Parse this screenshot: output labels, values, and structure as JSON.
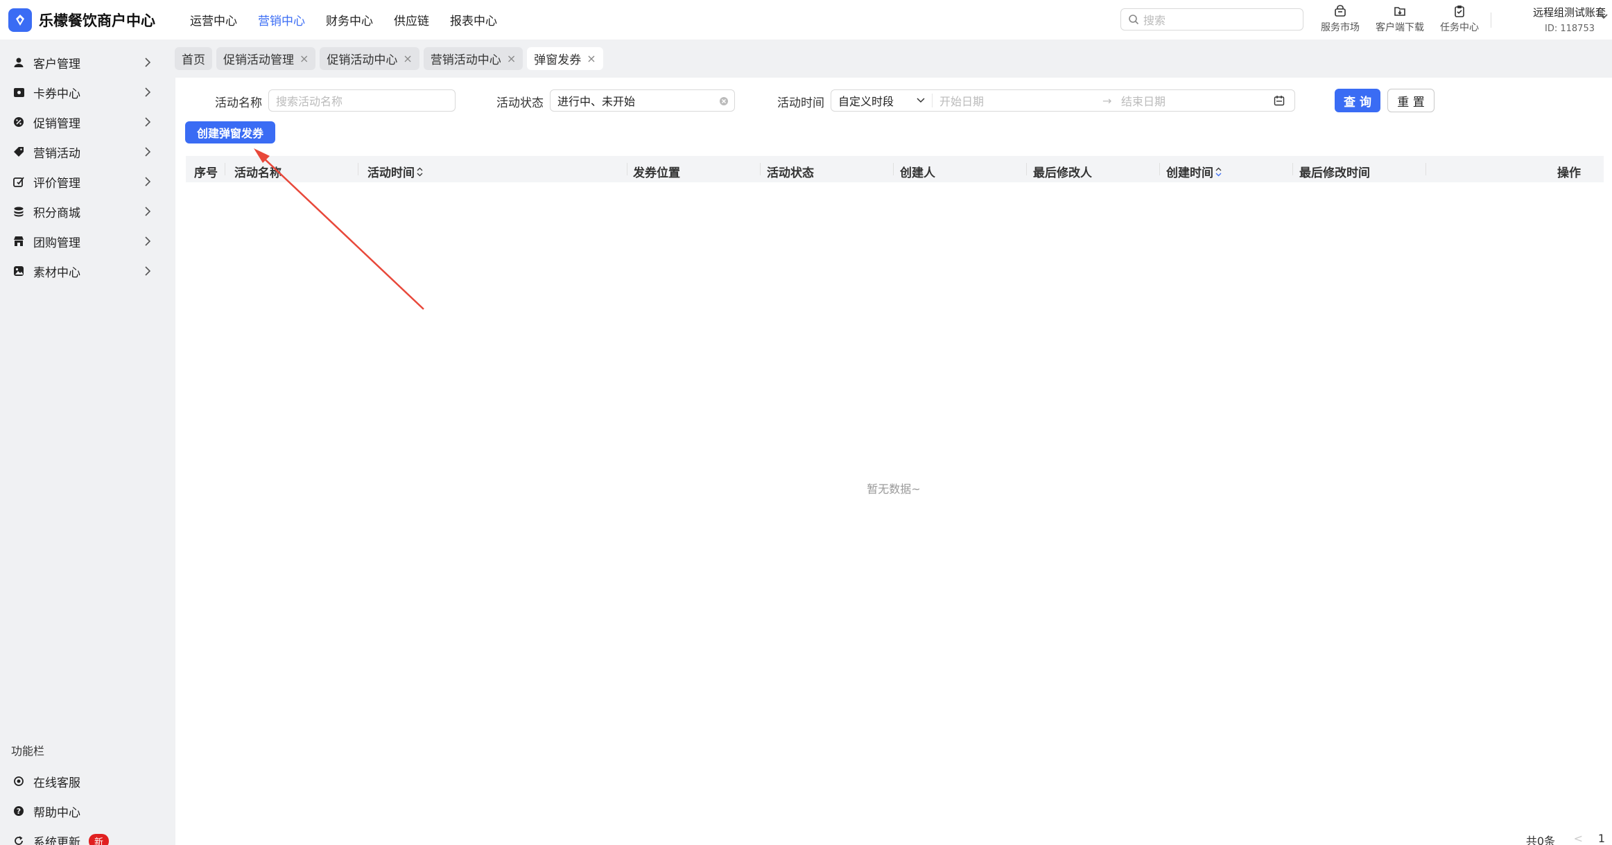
{
  "app": {
    "title": "乐檬餐饮商户中心"
  },
  "topnav": [
    {
      "label": "运营中心",
      "active": false
    },
    {
      "label": "营销中心",
      "active": true
    },
    {
      "label": "财务中心",
      "active": false
    },
    {
      "label": "供应链",
      "active": false
    },
    {
      "label": "报表中心",
      "active": false
    }
  ],
  "search": {
    "placeholder": "搜索"
  },
  "tools": [
    {
      "label": "服务市场",
      "icon": "store-icon"
    },
    {
      "label": "客户端下载",
      "icon": "download-icon"
    },
    {
      "label": "任务中心",
      "icon": "clipboard-icon"
    }
  ],
  "account": {
    "name": "远程组测试账套",
    "id": "ID: 118753"
  },
  "sidebar": {
    "items": [
      {
        "label": "客户管理",
        "icon": "user-icon"
      },
      {
        "label": "卡券中心",
        "icon": "card-icon"
      },
      {
        "label": "促销管理",
        "icon": "promo-icon"
      },
      {
        "label": "营销活动",
        "icon": "tag-icon"
      },
      {
        "label": "评价管理",
        "icon": "review-icon"
      },
      {
        "label": "积分商城",
        "icon": "points-icon"
      },
      {
        "label": "团购管理",
        "icon": "shop-icon"
      },
      {
        "label": "素材中心",
        "icon": "image-icon"
      }
    ],
    "function_title": "功能栏",
    "function_items": [
      {
        "label": "在线客服",
        "icon": "headset-icon"
      },
      {
        "label": "帮助中心",
        "icon": "help-icon"
      },
      {
        "label": "系统更新",
        "icon": "refresh-icon",
        "badge": "新"
      }
    ]
  },
  "tabs": [
    {
      "label": "首页",
      "closable": false,
      "active": false
    },
    {
      "label": "促销活动管理",
      "closable": true,
      "active": false
    },
    {
      "label": "促销活动中心",
      "closable": true,
      "active": false
    },
    {
      "label": "营销活动中心",
      "closable": true,
      "active": false
    },
    {
      "label": "弹窗发券",
      "closable": true,
      "active": true
    }
  ],
  "tab_close_glyph": "×",
  "filters": {
    "name_label": "活动名称",
    "name_placeholder": "搜索活动名称",
    "status_label": "活动状态",
    "status_value": "进行中、未开始",
    "time_label": "活动时间",
    "time_mode": "自定义时段",
    "start_placeholder": "开始日期",
    "range_sep": "→",
    "end_placeholder": "结束日期",
    "query_button": "查 询",
    "reset_button": "重 置"
  },
  "create_button": "创建弹窗发券",
  "table": {
    "columns": [
      "序号",
      "活动名称",
      "活动时间",
      "发券位置",
      "活动状态",
      "创建人",
      "最后修改人",
      "创建时间",
      "最后修改时间",
      "操作"
    ],
    "empty_text": "暂无数据~"
  },
  "pagination": {
    "total": "共0条",
    "prev": "<",
    "page": "1"
  },
  "colors": {
    "accent": "#3a6cf4",
    "annotation_arrow": "#e8483a"
  }
}
